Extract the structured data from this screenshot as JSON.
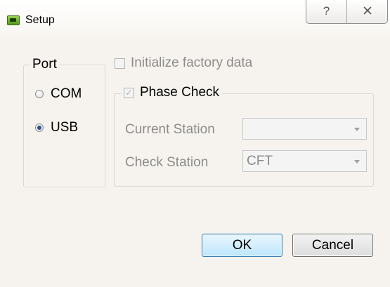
{
  "window": {
    "title": "Setup",
    "help_glyph": "?",
    "close_glyph": "X"
  },
  "port": {
    "title": "Port",
    "options": [
      {
        "label": "COM",
        "selected": false
      },
      {
        "label": "USB",
        "selected": true
      }
    ]
  },
  "initialize_factory_data": {
    "label": "Initialize factory data",
    "checked": false,
    "enabled": false
  },
  "phase_check": {
    "label": "Phase Check",
    "checked": true,
    "enabled": false,
    "current_station": {
      "label": "Current Station",
      "value": ""
    },
    "check_station": {
      "label": "Check Station",
      "value": "CFT"
    }
  },
  "buttons": {
    "ok": "OK",
    "cancel": "Cancel"
  },
  "colors": {
    "accent_ok_border": "#3c7fb1",
    "window_bg": "#f6f3ee",
    "disabled_text": "#8c8c8c",
    "icon_green": "#6bb52f"
  }
}
